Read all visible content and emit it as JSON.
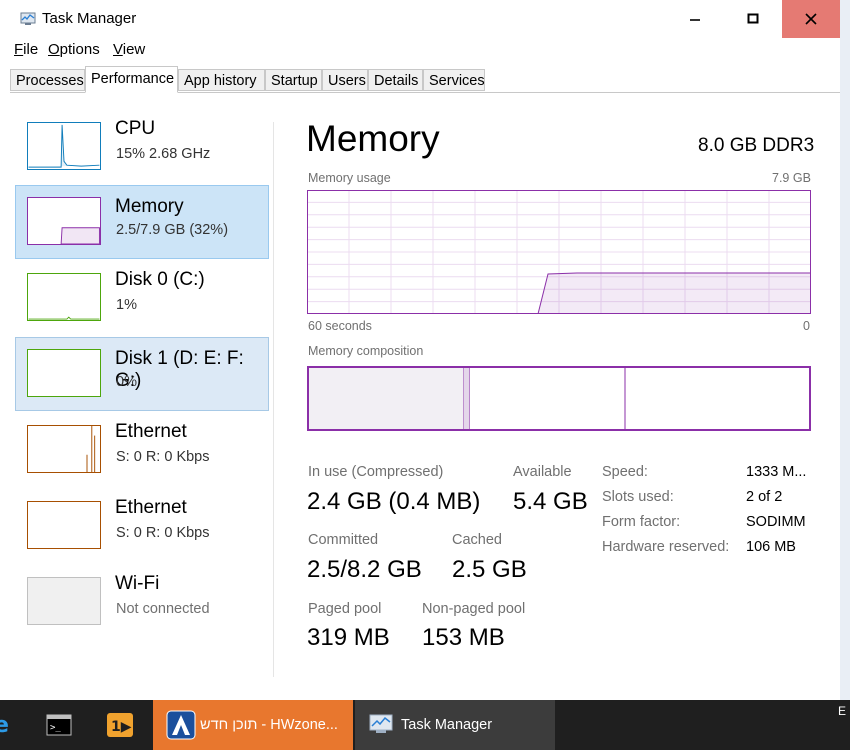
{
  "window": {
    "title": "Task Manager"
  },
  "menu": {
    "file": "F",
    "file_rest": "ile",
    "options": "O",
    "options_rest": "ptions",
    "view": "V",
    "view_rest": "iew"
  },
  "tabs": [
    "Processes",
    "Performance",
    "App history",
    "Startup",
    "Users",
    "Details",
    "Services"
  ],
  "active_tab": "Performance",
  "sidebar": {
    "items": [
      {
        "title": "CPU",
        "sub": "15%  2.68 GHz"
      },
      {
        "title": "Memory",
        "sub": "2.5/7.9 GB (32%)"
      },
      {
        "title": "Disk 0 (C:)",
        "sub": "1%"
      },
      {
        "title": "Disk 1 (D: E: F: G:)",
        "sub": "0%"
      },
      {
        "title": "Ethernet",
        "sub": "S: 0  R: 0 Kbps"
      },
      {
        "title": "Ethernet",
        "sub": "S: 0  R: 0 Kbps"
      },
      {
        "title": "Wi-Fi",
        "sub": "Not connected"
      }
    ]
  },
  "memory": {
    "heading": "Memory",
    "type": "8.0 GB DDR3",
    "usage_label": "Memory usage",
    "usage_max": "7.9 GB",
    "seconds_label": "60 seconds",
    "seconds_zero": "0",
    "composition_label": "Memory composition",
    "in_use_label": "In use (Compressed)",
    "in_use_value": "2.4 GB (0.4 MB)",
    "available_label": "Available",
    "available_value": "5.4 GB",
    "committed_label": "Committed",
    "committed_value": "2.5/8.2 GB",
    "cached_label": "Cached",
    "cached_value": "2.5 GB",
    "paged_label": "Paged pool",
    "paged_value": "319 MB",
    "nonpaged_label": "Non-paged pool",
    "nonpaged_value": "153 MB",
    "details": [
      {
        "key": "Speed:",
        "value": "1333 M..."
      },
      {
        "key": "Slots used:",
        "value": "2 of 2"
      },
      {
        "key": "Form factor:",
        "value": "SODIMM"
      },
      {
        "key": "Hardware reserved:",
        "value": "106 MB"
      }
    ]
  },
  "taskbar": {
    "hwzone_label": "תוכן חדש - HWzone...",
    "taskmgr_label": "Task Manager",
    "tray_text": "E"
  },
  "colors": {
    "memory_accent": "#8b2fa8",
    "cpu_accent": "#117dbb",
    "disk_accent": "#4da60c",
    "eth_accent": "#a74f01"
  }
}
